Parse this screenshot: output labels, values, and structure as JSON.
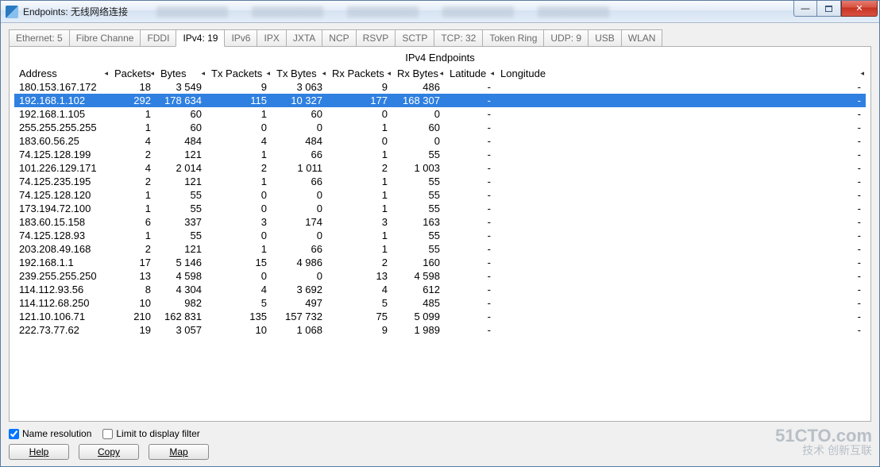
{
  "window": {
    "title": "Endpoints: 无线网络连接"
  },
  "tabs": [
    {
      "label": "Ethernet: 5",
      "active": false
    },
    {
      "label": "Fibre Channe",
      "active": false
    },
    {
      "label": "FDDI",
      "active": false
    },
    {
      "label": "IPv4: 19",
      "active": true
    },
    {
      "label": "IPv6",
      "active": false
    },
    {
      "label": "IPX",
      "active": false
    },
    {
      "label": "JXTA",
      "active": false
    },
    {
      "label": "NCP",
      "active": false
    },
    {
      "label": "RSVP",
      "active": false
    },
    {
      "label": "SCTP",
      "active": false
    },
    {
      "label": "TCP: 32",
      "active": false
    },
    {
      "label": "Token Ring",
      "active": false
    },
    {
      "label": "UDP: 9",
      "active": false
    },
    {
      "label": "USB",
      "active": false
    },
    {
      "label": "WLAN",
      "active": false
    }
  ],
  "panel": {
    "title": "IPv4 Endpoints",
    "columns": [
      "Address",
      "Packets",
      "Bytes",
      "Tx Packets",
      "Tx Bytes",
      "Rx Packets",
      "Rx Bytes",
      "Latitude",
      "Longitude"
    ],
    "rows": [
      {
        "addr": "180.153.167.172",
        "pk": "18",
        "by": "3 549",
        "tp": "9",
        "tb": "3 063",
        "rp": "9",
        "rb": "486",
        "lat": "-",
        "lon": "-",
        "sel": false
      },
      {
        "addr": "192.168.1.102",
        "pk": "292",
        "by": "178 634",
        "tp": "115",
        "tb": "10 327",
        "rp": "177",
        "rb": "168 307",
        "lat": "-",
        "lon": "-",
        "sel": true
      },
      {
        "addr": "192.168.1.105",
        "pk": "1",
        "by": "60",
        "tp": "1",
        "tb": "60",
        "rp": "0",
        "rb": "0",
        "lat": "-",
        "lon": "-",
        "sel": false
      },
      {
        "addr": "255.255.255.255",
        "pk": "1",
        "by": "60",
        "tp": "0",
        "tb": "0",
        "rp": "1",
        "rb": "60",
        "lat": "-",
        "lon": "-",
        "sel": false
      },
      {
        "addr": "183.60.56.25",
        "pk": "4",
        "by": "484",
        "tp": "4",
        "tb": "484",
        "rp": "0",
        "rb": "0",
        "lat": "-",
        "lon": "-",
        "sel": false
      },
      {
        "addr": "74.125.128.199",
        "pk": "2",
        "by": "121",
        "tp": "1",
        "tb": "66",
        "rp": "1",
        "rb": "55",
        "lat": "-",
        "lon": "-",
        "sel": false
      },
      {
        "addr": "101.226.129.171",
        "pk": "4",
        "by": "2 014",
        "tp": "2",
        "tb": "1 011",
        "rp": "2",
        "rb": "1 003",
        "lat": "-",
        "lon": "-",
        "sel": false
      },
      {
        "addr": "74.125.235.195",
        "pk": "2",
        "by": "121",
        "tp": "1",
        "tb": "66",
        "rp": "1",
        "rb": "55",
        "lat": "-",
        "lon": "-",
        "sel": false
      },
      {
        "addr": "74.125.128.120",
        "pk": "1",
        "by": "55",
        "tp": "0",
        "tb": "0",
        "rp": "1",
        "rb": "55",
        "lat": "-",
        "lon": "-",
        "sel": false
      },
      {
        "addr": "173.194.72.100",
        "pk": "1",
        "by": "55",
        "tp": "0",
        "tb": "0",
        "rp": "1",
        "rb": "55",
        "lat": "-",
        "lon": "-",
        "sel": false
      },
      {
        "addr": "183.60.15.158",
        "pk": "6",
        "by": "337",
        "tp": "3",
        "tb": "174",
        "rp": "3",
        "rb": "163",
        "lat": "-",
        "lon": "-",
        "sel": false
      },
      {
        "addr": "74.125.128.93",
        "pk": "1",
        "by": "55",
        "tp": "0",
        "tb": "0",
        "rp": "1",
        "rb": "55",
        "lat": "-",
        "lon": "-",
        "sel": false
      },
      {
        "addr": "203.208.49.168",
        "pk": "2",
        "by": "121",
        "tp": "1",
        "tb": "66",
        "rp": "1",
        "rb": "55",
        "lat": "-",
        "lon": "-",
        "sel": false
      },
      {
        "addr": "192.168.1.1",
        "pk": "17",
        "by": "5 146",
        "tp": "15",
        "tb": "4 986",
        "rp": "2",
        "rb": "160",
        "lat": "-",
        "lon": "-",
        "sel": false
      },
      {
        "addr": "239.255.255.250",
        "pk": "13",
        "by": "4 598",
        "tp": "0",
        "tb": "0",
        "rp": "13",
        "rb": "4 598",
        "lat": "-",
        "lon": "-",
        "sel": false
      },
      {
        "addr": "114.112.93.56",
        "pk": "8",
        "by": "4 304",
        "tp": "4",
        "tb": "3 692",
        "rp": "4",
        "rb": "612",
        "lat": "-",
        "lon": "-",
        "sel": false
      },
      {
        "addr": "114.112.68.250",
        "pk": "10",
        "by": "982",
        "tp": "5",
        "tb": "497",
        "rp": "5",
        "rb": "485",
        "lat": "-",
        "lon": "-",
        "sel": false
      },
      {
        "addr": "121.10.106.71",
        "pk": "210",
        "by": "162 831",
        "tp": "135",
        "tb": "157 732",
        "rp": "75",
        "rb": "5 099",
        "lat": "-",
        "lon": "-",
        "sel": false
      },
      {
        "addr": "222.73.77.62",
        "pk": "19",
        "by": "3 057",
        "tp": "10",
        "tb": "1 068",
        "rp": "9",
        "rb": "1 989",
        "lat": "-",
        "lon": "-",
        "sel": false
      }
    ]
  },
  "checks": {
    "name_resolution": {
      "label": "Name resolution",
      "checked": true
    },
    "display_filter": {
      "label": "Limit to display filter",
      "checked": false
    }
  },
  "buttons": {
    "help": "Help",
    "copy": "Copy",
    "map": "Map"
  },
  "watermark": {
    "line1": "51CTO.com",
    "line2": "技术  创新互联"
  }
}
